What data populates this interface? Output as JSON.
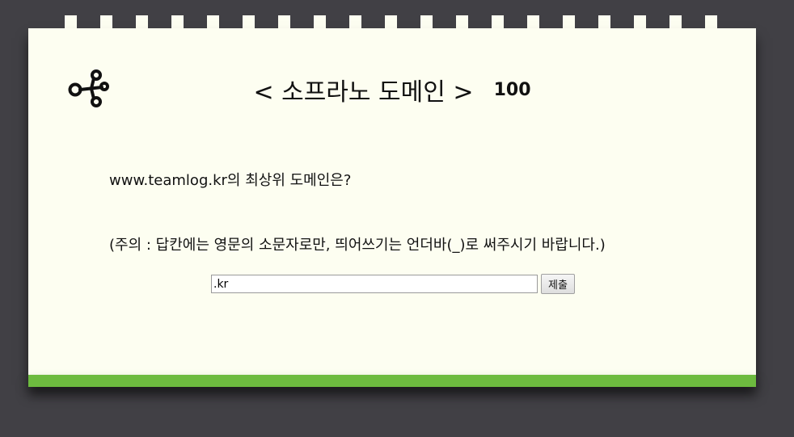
{
  "header": {
    "title": "< 소프라노 도메인 >",
    "score": "100"
  },
  "question": {
    "text": "www.teamlog.kr의 최상위 도메인은?"
  },
  "notice": {
    "text": "(주의 : 답칸에는 영문의 소문자로만, 띄어쓰기는 언더바(_)로 써주시기 바랍니다.)"
  },
  "answer": {
    "value": ".kr",
    "submit_label": "제출"
  },
  "icons": {
    "header_icon": "share-icon"
  },
  "colors": {
    "background": "#414045",
    "card": "#fdfef1",
    "accent_bar": "#6dbb3f"
  }
}
